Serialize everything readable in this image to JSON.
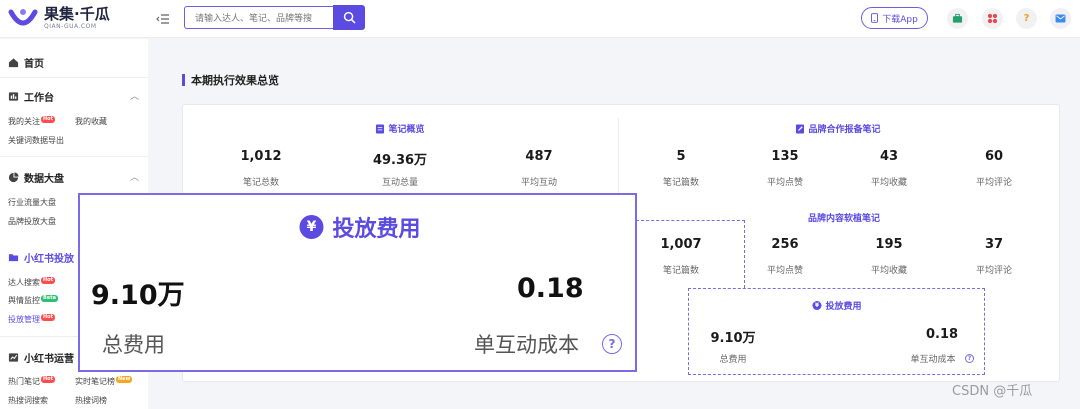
{
  "header": {
    "logo_name": "果集·千瓜",
    "logo_sub": "QIAN-GUA.COM",
    "search_placeholder": "请输入达人、笔记、品牌等搜",
    "download_label": "下载App",
    "top_icons": [
      "briefcase-icon",
      "apps-icon",
      "help-icon",
      "message-icon"
    ],
    "help_glyph": "?"
  },
  "sidebar": {
    "home": "首页",
    "workbench": {
      "title": "工作台",
      "items": [
        {
          "label": "我的关注",
          "tag": "Hot"
        },
        {
          "label": "我的收藏",
          "tag": ""
        },
        {
          "label": "关键词数据导出",
          "tag": ""
        }
      ]
    },
    "data": {
      "title": "数据大盘",
      "items": [
        {
          "label": "行业流量大盘",
          "tag": ""
        },
        {
          "label": "品牌投放大盘",
          "tag": ""
        }
      ]
    },
    "xhs_ads": {
      "title": "小红书投放",
      "items": [
        {
          "label": "达人搜索",
          "tag": "Hot"
        },
        {
          "label": "舆情监控",
          "tag": "Beta"
        },
        {
          "label": "投放管理",
          "tag": "Hot"
        }
      ]
    },
    "xhs_ops": {
      "title": "小红书运营",
      "items": [
        {
          "label": "热门笔记",
          "tag": "Hot"
        },
        {
          "label": "实时笔记榜",
          "tag": "New"
        },
        {
          "label": "热搜词搜索",
          "tag": ""
        },
        {
          "label": "热搜词榜",
          "tag": ""
        }
      ]
    }
  },
  "main": {
    "section_title": "本期执行效果总览",
    "notes_overview": {
      "title": "笔记概览",
      "stats": [
        {
          "value": "1,012",
          "label": "笔记总数"
        },
        {
          "value": "49.36万",
          "label": "互动总量"
        },
        {
          "value": "487",
          "label": "平均互动"
        }
      ]
    },
    "brand_coop": {
      "title": "品牌合作报备笔记",
      "stats": [
        {
          "value": "5",
          "label": "笔记篇数"
        },
        {
          "value": "135",
          "label": "平均点赞"
        },
        {
          "value": "43",
          "label": "平均收藏"
        },
        {
          "value": "60",
          "label": "平均评论"
        }
      ]
    },
    "brand_content": {
      "title": "品牌内容软植笔记",
      "stats": [
        {
          "value": "1,007",
          "label": "笔记篇数"
        },
        {
          "value": "256",
          "label": "平均点赞"
        },
        {
          "value": "195",
          "label": "平均收藏"
        },
        {
          "value": "37",
          "label": "平均评论"
        }
      ]
    },
    "ad_cost": {
      "title": "投放费用",
      "coin_glyph": "¥",
      "total_value": "9.10万",
      "total_label": "总费用",
      "unit_value": "0.18",
      "unit_label": "单互动成本"
    }
  },
  "watermark": "CSDN @千瓜",
  "colors": {
    "accent": "#5b4be0",
    "hot": "#ff4d4f",
    "beta": "#2fbf71",
    "new": "#f5a623"
  }
}
